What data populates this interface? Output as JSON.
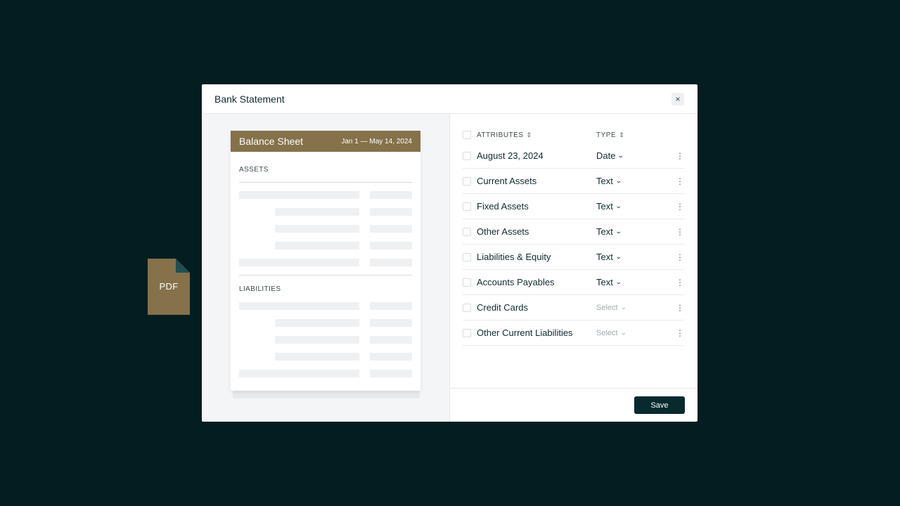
{
  "modal": {
    "title": "Bank Statement",
    "close_icon": "×"
  },
  "file_icon": {
    "label": "PDF",
    "color": "#85714a"
  },
  "document": {
    "title": "Balance Sheet",
    "date_range": "Jan 1 — May 14, 2024",
    "sections": [
      "ASSETS",
      "LIABILITIES"
    ],
    "accent": "#85714a"
  },
  "table": {
    "headers": {
      "attributes": "ATTRIBUTES",
      "type": "TYPE"
    },
    "rows": [
      {
        "attribute": "August 23, 2024",
        "type": "Date",
        "is_placeholder": false
      },
      {
        "attribute": "Current Assets",
        "type": "Text",
        "is_placeholder": false
      },
      {
        "attribute": "Fixed Assets",
        "type": "Text",
        "is_placeholder": false
      },
      {
        "attribute": "Other Assets",
        "type": "Text",
        "is_placeholder": false
      },
      {
        "attribute": "Liabilities & Equity",
        "type": "Text",
        "is_placeholder": false
      },
      {
        "attribute": "Accounts Payables",
        "type": "Text",
        "is_placeholder": false
      },
      {
        "attribute": "Credit Cards",
        "type": "Select",
        "is_placeholder": true
      },
      {
        "attribute": "Other Current Liabilities",
        "type": "Select",
        "is_placeholder": true
      }
    ]
  },
  "footer": {
    "save_label": "Save"
  },
  "colors": {
    "background": "#031d21",
    "primary_button": "#082a2f"
  }
}
